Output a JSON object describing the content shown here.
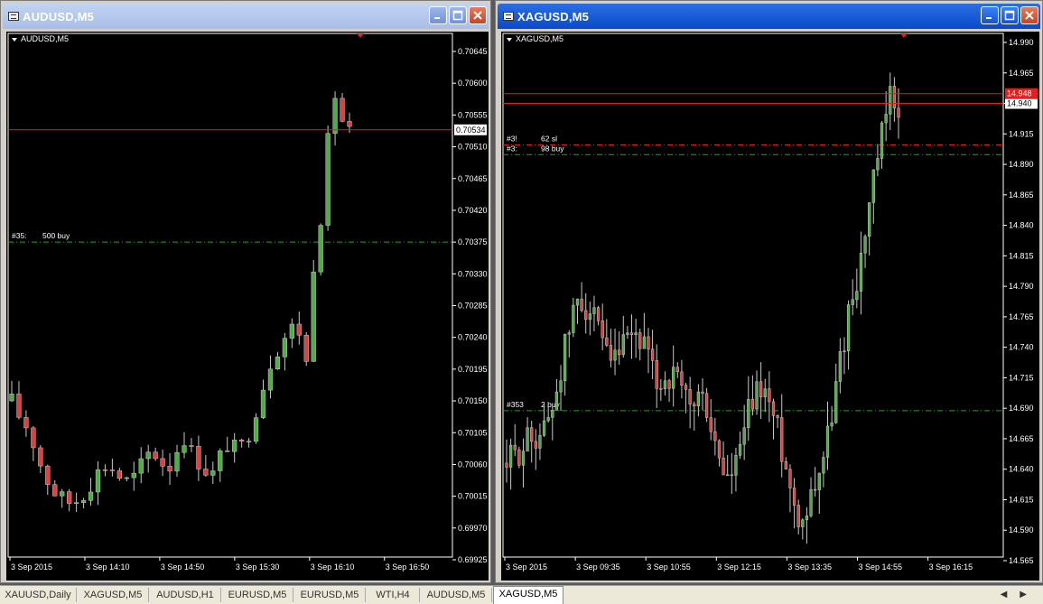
{
  "windows": [
    {
      "title": "AUDUSD,M5",
      "chart_label": "AUDUSD,M5",
      "price_ticks": [
        "0.70645",
        "0.70600",
        "0.70555",
        "0.70510",
        "0.70465",
        "0.70420",
        "0.70375",
        "0.70330",
        "0.70285",
        "0.70240",
        "0.70195",
        "0.70150",
        "0.70105",
        "0.70060",
        "0.70015",
        "0.69970",
        "0.69925"
      ],
      "current_price": "0.70534",
      "time_labels": [
        "3 Sep 2015",
        "3 Sep 14:10",
        "3 Sep 14:50",
        "3 Sep 15:30",
        "3 Sep 16:10",
        "3 Sep 16:50"
      ],
      "order_lines": [
        {
          "id": "#35:",
          "label": "500 buy",
          "price": 0.70375,
          "color": "#1aa51a",
          "style": "dashdot"
        }
      ]
    },
    {
      "title": "XAGUSD,M5",
      "chart_label": "XAGUSD,M5",
      "price_ticks": [
        "14.990",
        "14.965",
        "14.940",
        "14.915",
        "14.890",
        "14.865",
        "14.840",
        "14.815",
        "14.790",
        "14.765",
        "14.740",
        "14.715",
        "14.690",
        "14.665",
        "14.640",
        "14.615",
        "14.590",
        "14.565"
      ],
      "current_price": "14.940",
      "ask_price": "14.948",
      "time_labels": [
        "3 Sep 2015",
        "3 Sep 09:35",
        "3 Sep 10:55",
        "3 Sep 12:15",
        "3 Sep 13:35",
        "3 Sep 14:55",
        "3 Sep 16:15"
      ],
      "order_lines": [
        {
          "id": "#3!",
          "label": "62 sl",
          "price": 14.906,
          "color": "#e02020",
          "style": "dashdot"
        },
        {
          "id": "#3:",
          "label": "98 buy",
          "price": 14.898,
          "color": "#1aa51a",
          "style": "dashdot"
        },
        {
          "id": "#353",
          "label": "2 buy",
          "price": 14.688,
          "color": "#1aa51a",
          "style": "dashdot"
        }
      ]
    }
  ],
  "tabs": [
    "XAUUSD,Daily",
    "XAGUSD,M5",
    "AUDUSD,H1",
    "EURUSD,M5",
    "EURUSD,M5",
    "WTI,H4",
    "AUDUSD,M5",
    "XAGUSD,M5"
  ],
  "active_tab_index": 7,
  "chart_data": [
    {
      "type": "candlestick",
      "symbol": "AUDUSD",
      "timeframe": "M5",
      "ylim": [
        0.69925,
        0.70645
      ],
      "current_price": 0.70534,
      "x": [
        "3 Sep 2015",
        "3 Sep 14:10",
        "3 Sep 14:50",
        "3 Sep 15:30",
        "3 Sep 16:10",
        "3 Sep 16:50"
      ],
      "closes_approx": [
        0.7015,
        0.70125,
        0.7011,
        0.7007,
        0.7004,
        0.7002,
        0.7001,
        0.70005,
        0.70015,
        0.7003,
        0.7005,
        0.7006,
        0.7005,
        0.70035,
        0.7004,
        0.7006,
        0.7008,
        0.7007,
        0.7005,
        0.7008,
        0.701,
        0.7007,
        0.7006,
        0.7004,
        0.7007,
        0.7009,
        0.7008,
        0.7009,
        0.7013,
        0.7017,
        0.7021,
        0.7023,
        0.7025,
        0.7026,
        0.702,
        0.7037,
        0.7043,
        0.706,
        0.7055,
        0.7053
      ]
    },
    {
      "type": "candlestick",
      "symbol": "XAGUSD",
      "timeframe": "M5",
      "ylim": [
        14.565,
        14.99
      ],
      "current_price": 14.94,
      "x": [
        "3 Sep 2015",
        "3 Sep 09:35",
        "3 Sep 10:55",
        "3 Sep 12:15",
        "3 Sep 13:35",
        "3 Sep 14:55",
        "3 Sep 16:15"
      ],
      "closes_approx": [
        14.645,
        14.65,
        14.66,
        14.665,
        14.67,
        14.675,
        14.7,
        14.73,
        14.76,
        14.78,
        14.775,
        14.76,
        14.74,
        14.72,
        14.735,
        14.74,
        14.75,
        14.745,
        14.72,
        14.71,
        14.715,
        14.715,
        14.7,
        14.69,
        14.7,
        14.69,
        14.66,
        14.64,
        14.63,
        14.65,
        14.68,
        14.7,
        14.71,
        14.69,
        14.67,
        14.64,
        14.61,
        14.6,
        14.62,
        14.64,
        14.66,
        14.7,
        14.74,
        14.78,
        14.8,
        14.84,
        14.88,
        14.915,
        14.945,
        14.94
      ]
    }
  ]
}
